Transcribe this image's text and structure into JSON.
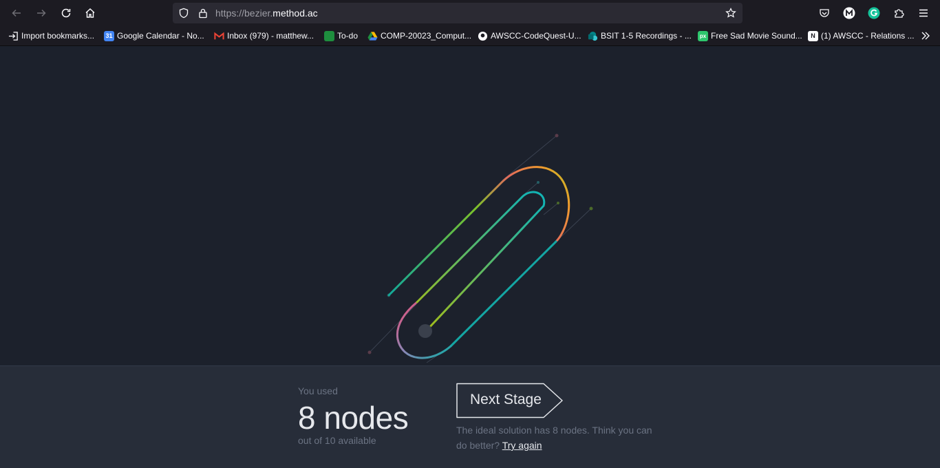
{
  "browser": {
    "url_scheme": "https://bezier.",
    "url_host": "method.ac",
    "bookmarks": [
      {
        "label": "Import bookmarks...",
        "icon": "import-icon",
        "color": "#fbfbfe"
      },
      {
        "label": "Google Calendar - No...",
        "icon": "google-calendar-icon",
        "color": "#4285f4"
      },
      {
        "label": "Inbox (979) - matthew...",
        "icon": "gmail-icon",
        "color": "#ea4335"
      },
      {
        "label": "To-do",
        "icon": "classroom-icon",
        "color": "#1e8e3e"
      },
      {
        "label": "COMP-20023_Comput...",
        "icon": "google-drive-icon",
        "color": "#fbbc04"
      },
      {
        "label": "AWSCC-CodeQuest-U...",
        "icon": "github-icon",
        "color": "#fbfbfe"
      },
      {
        "label": "BSIT 1-5 Recordings - ...",
        "icon": "sharepoint-icon",
        "color": "#038387"
      },
      {
        "label": "Free Sad Movie Sound...",
        "icon": "pixabay-icon",
        "color": "#2ec66d"
      },
      {
        "label": "(1) AWSCC - Relations ...",
        "icon": "notion-icon",
        "color": "#fbfbfe"
      }
    ]
  },
  "result": {
    "used_label": "You used",
    "node_count": "8 nodes",
    "available": "out of 10 available",
    "next_label": "Next Stage",
    "ideal_text": "The ideal solution has 8 nodes. Think you can do better?",
    "try_again": "Try again"
  }
}
